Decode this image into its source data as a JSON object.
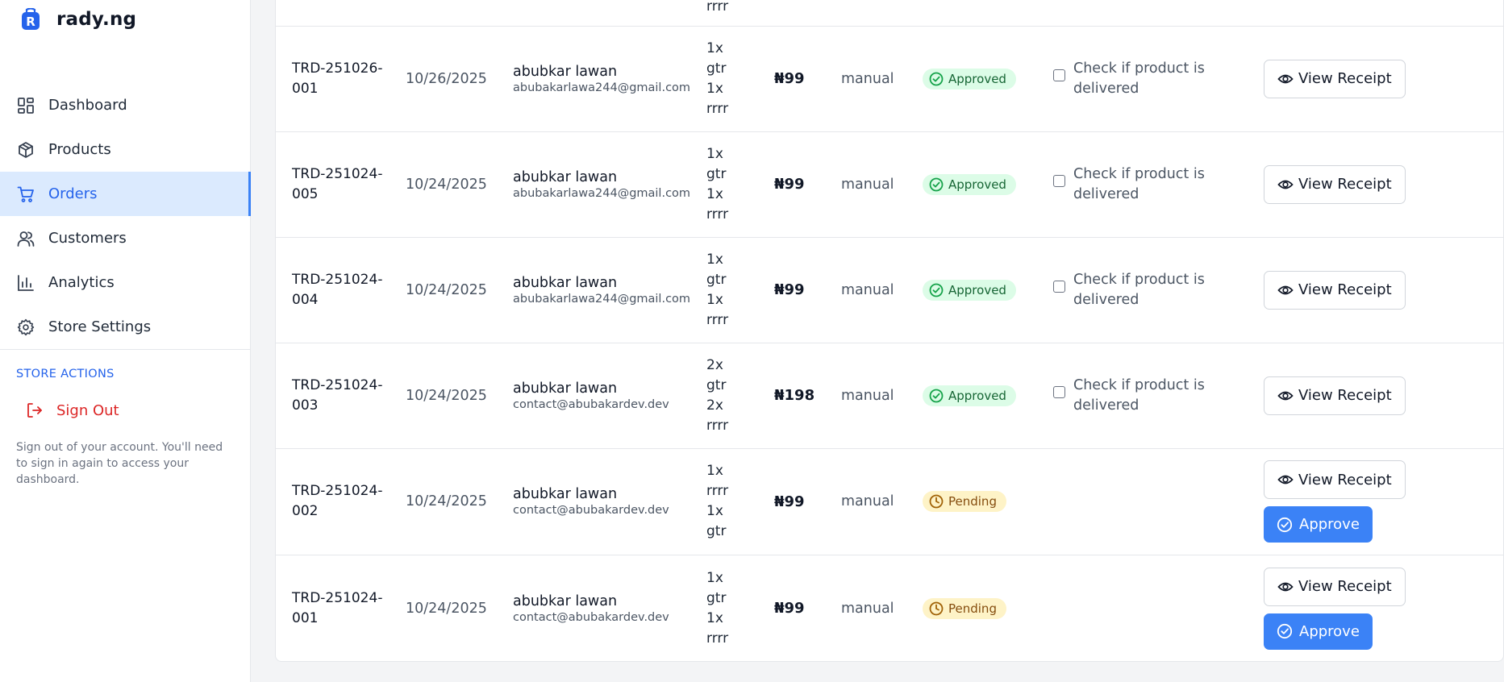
{
  "app": {
    "name": "rady.ng"
  },
  "nav": [
    {
      "label": "Dashboard",
      "icon": "dashboard-icon",
      "active": false
    },
    {
      "label": "Products",
      "icon": "box-icon",
      "active": false
    },
    {
      "label": "Orders",
      "icon": "cart-icon",
      "active": true
    },
    {
      "label": "Customers",
      "icon": "users-icon",
      "active": false
    },
    {
      "label": "Analytics",
      "icon": "bar-chart-icon",
      "active": false
    },
    {
      "label": "Store Settings",
      "icon": "gear-icon",
      "active": false
    }
  ],
  "store_actions": {
    "title": "STORE ACTIONS",
    "sign_out": "Sign Out",
    "help": "Sign out of your account. You'll need to sign in again to access your dashboard."
  },
  "top_partial": {
    "item_text": "rrrr"
  },
  "labels": {
    "check_delivered": "Check if product is delivered",
    "view_receipt": "View Receipt",
    "approve": "Approve"
  },
  "colors": {
    "accent": "#3b82f6",
    "approved_bg": "#dcfce7",
    "pending_bg": "#fef3c7",
    "danger": "#dc2626"
  },
  "orders": [
    {
      "id_line1": "TRD-251026-",
      "id_line2": "001",
      "date": "10/26/2025",
      "customer": "abubkar lawan",
      "email": "abubakarlawa244@gmail.com",
      "items": [
        "1x",
        "gtr",
        "1x",
        "rrrr"
      ],
      "total": "₦99",
      "method": "manual",
      "status": "Approved"
    },
    {
      "id_line1": "TRD-251024-",
      "id_line2": "005",
      "date": "10/24/2025",
      "customer": "abubkar lawan",
      "email": "abubakarlawa244@gmail.com",
      "items": [
        "1x",
        "gtr",
        "1x",
        "rrrr"
      ],
      "total": "₦99",
      "method": "manual",
      "status": "Approved"
    },
    {
      "id_line1": "TRD-251024-",
      "id_line2": "004",
      "date": "10/24/2025",
      "customer": "abubkar lawan",
      "email": "abubakarlawa244@gmail.com",
      "items": [
        "1x",
        "gtr",
        "1x",
        "rrrr"
      ],
      "total": "₦99",
      "method": "manual",
      "status": "Approved"
    },
    {
      "id_line1": "TRD-251024-",
      "id_line2": "003",
      "date": "10/24/2025",
      "customer": "abubkar lawan",
      "email": "contact@abubakardev.dev",
      "items": [
        "2x",
        "gtr",
        "2x",
        "rrrr"
      ],
      "total": "₦198",
      "method": "manual",
      "status": "Approved"
    },
    {
      "id_line1": "TRD-251024-",
      "id_line2": "002",
      "date": "10/24/2025",
      "customer": "abubkar lawan",
      "email": "contact@abubakardev.dev",
      "items": [
        "1x",
        "rrrr",
        "1x",
        "gtr"
      ],
      "total": "₦99",
      "method": "manual",
      "status": "Pending"
    },
    {
      "id_line1": "TRD-251024-",
      "id_line2": "001",
      "date": "10/24/2025",
      "customer": "abubkar lawan",
      "email": "contact@abubakardev.dev",
      "items": [
        "1x",
        "gtr",
        "1x",
        "rrrr"
      ],
      "total": "₦99",
      "method": "manual",
      "status": "Pending"
    }
  ]
}
